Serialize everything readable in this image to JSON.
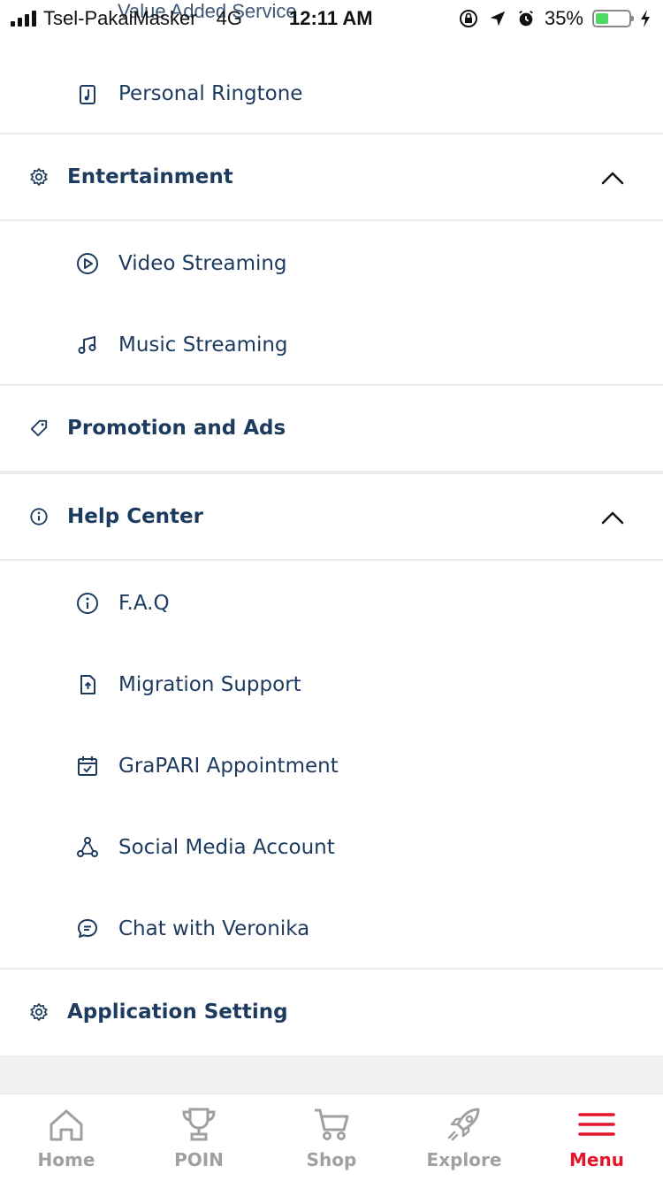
{
  "status_bar": {
    "carrier": "Tsel-PakaiMasker",
    "network": "4G",
    "time": "12:11 AM",
    "battery": "35%",
    "battery_level": 0.35,
    "ghost_header": "Value Added Service"
  },
  "menu": {
    "sections": [
      {
        "id": "vas",
        "items": [
          {
            "label": "Personal Ringtone",
            "icon": "music-note-file-icon"
          }
        ]
      },
      {
        "id": "entertainment",
        "title": "Entertainment",
        "icon": "gear-icon",
        "expanded": true,
        "items": [
          {
            "label": "Video Streaming",
            "icon": "play-circle-icon"
          },
          {
            "label": "Music Streaming",
            "icon": "music-notes-icon"
          }
        ]
      },
      {
        "id": "promotion",
        "title": "Promotion and Ads",
        "icon": "tag-icon"
      },
      {
        "id": "help",
        "title": "Help Center",
        "icon": "info-icon",
        "expanded": true,
        "items": [
          {
            "label": "F.A.Q",
            "icon": "info-circle-icon"
          },
          {
            "label": "Migration Support",
            "icon": "upload-file-icon"
          },
          {
            "label": "GraPARI Appointment",
            "icon": "calendar-check-icon"
          },
          {
            "label": "Social Media Account",
            "icon": "social-network-icon"
          },
          {
            "label": "Chat with Veronika",
            "icon": "chat-bubble-icon"
          }
        ]
      },
      {
        "id": "app_setting",
        "title": "Application Setting",
        "icon": "gear-icon"
      }
    ]
  },
  "bottom_nav": {
    "items": [
      {
        "label": "Home",
        "icon": "home-icon"
      },
      {
        "label": "POIN",
        "icon": "trophy-icon"
      },
      {
        "label": "Shop",
        "icon": "cart-icon"
      },
      {
        "label": "Explore",
        "icon": "rocket-icon"
      },
      {
        "label": "Menu",
        "icon": "hamburger-icon",
        "active": true
      }
    ]
  },
  "colors": {
    "text": "#1d3a5f",
    "accent": "#e4162a",
    "inactive": "#a0a0a0",
    "divider": "#e8e8e8"
  }
}
